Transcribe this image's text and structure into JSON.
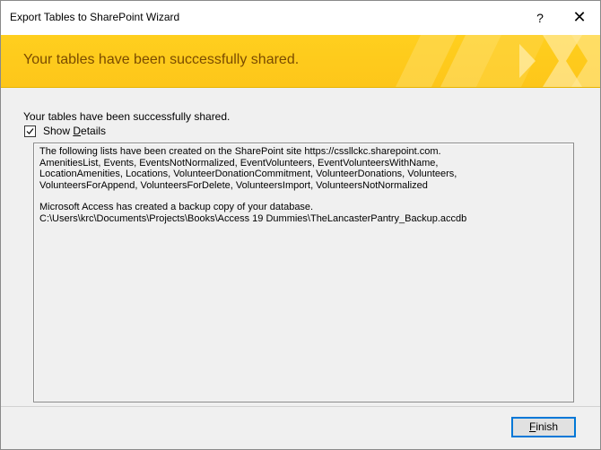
{
  "window": {
    "title": "Export Tables to SharePoint Wizard",
    "help_label": "?",
    "close_label": "✕"
  },
  "banner": {
    "heading": "Your tables have been successfully shared.",
    "accent_color": "#fdc61a",
    "text_color": "#7a4b00"
  },
  "main": {
    "success_message": "Your tables have been successfully shared.",
    "show_details": {
      "checked": true,
      "label_prefix": "Show ",
      "label_accel": "D",
      "label_rest": "etails"
    },
    "details": {
      "paragraph1": "The following lists have been created on the SharePoint site https://cssllckc.sharepoint.com.\nAmenitiesList, Events, EventsNotNormalized, EventVolunteers, EventVolunteersWithName,\nLocationAmenities, Locations, VolunteerDonationCommitment, VolunteerDonations, Volunteers,\nVolunteersForAppend, VolunteersForDelete, VolunteersImport, VolunteersNotNormalized",
      "paragraph2": "Microsoft Access has created a backup copy of your database.\nC:\\Users\\krc\\Documents\\Projects\\Books\\Access 19 Dummies\\TheLancasterPantry_Backup.accdb"
    }
  },
  "footer": {
    "finish_accel": "F",
    "finish_rest": "inish"
  }
}
